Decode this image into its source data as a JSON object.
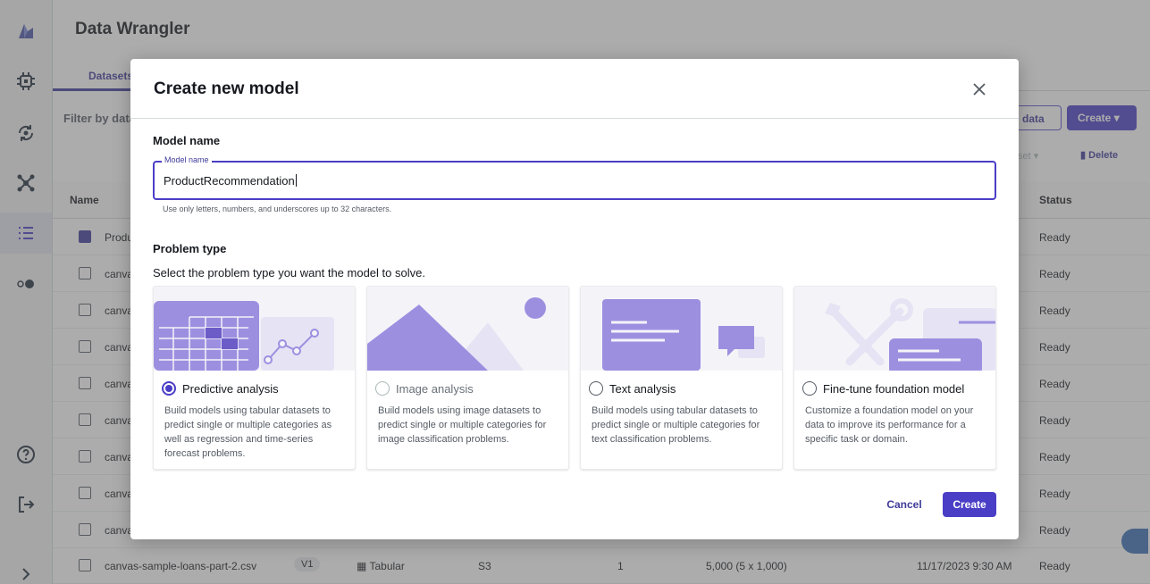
{
  "app": {
    "title": "Data Wrangler",
    "tab": "Datasets",
    "filter_label": "Filter by data",
    "import_label": "data",
    "create_label": "Create",
    "dataset_dropdown": "set",
    "delete_label": "Delete"
  },
  "table": {
    "headers": {
      "name": "Name",
      "status": "Status"
    },
    "rows": [
      {
        "name": "Produ",
        "status": "Ready",
        "checked": true
      },
      {
        "name": "canva",
        "status": "Ready"
      },
      {
        "name": "canva",
        "status": "Ready"
      },
      {
        "name": "canva",
        "status": "Ready"
      },
      {
        "name": "canva",
        "status": "Ready"
      },
      {
        "name": "canva",
        "status": "Ready"
      },
      {
        "name": "canva",
        "status": "Ready"
      },
      {
        "name": "canva",
        "status": "Ready"
      },
      {
        "name": "canva",
        "status": "Ready"
      },
      {
        "name": "canvas-sample-loans-part-2.csv",
        "version": "V1",
        "type": "Tabular",
        "source": "S3",
        "columns": "1",
        "cells": "5,000 (5 x 1,000)",
        "date": "11/17/2023 9:30 AM",
        "status": "Ready"
      }
    ]
  },
  "modal": {
    "title": "Create new model",
    "model_name_heading": "Model name",
    "model_name_legend": "Model name",
    "model_name_value": "ProductRecommendation",
    "model_name_hint": "Use only letters, numbers, and underscores up to 32 characters.",
    "problem_type_heading": "Problem type",
    "problem_type_subtext": "Select the problem type you want the model to solve.",
    "cards": [
      {
        "label": "Predictive analysis",
        "selected": true,
        "disabled": false,
        "description": "Build models using tabular datasets to predict single or multiple categories as well as regression and time-series forecast problems."
      },
      {
        "label": "Image analysis",
        "selected": false,
        "disabled": true,
        "description": "Build models using image datasets to predict single or multiple categories for image classification problems."
      },
      {
        "label": "Text analysis",
        "selected": false,
        "disabled": false,
        "description": "Build models using tabular datasets to predict single or multiple categories for text classification problems."
      },
      {
        "label": "Fine-tune foundation model",
        "selected": false,
        "disabled": false,
        "description": "Customize a foundation model on your data to improve its performance for a specific task or domain."
      }
    ],
    "cancel_label": "Cancel",
    "create_label": "Create"
  },
  "colors": {
    "accent": "#4a3ec6",
    "illustration": "#9d8fe0",
    "illustration_light": "#e6e3f4"
  },
  "icons": {
    "sidebar": [
      "logo-icon",
      "chip-icon",
      "refresh-icon",
      "network-icon",
      "list-icon",
      "toggle-icon",
      "help-icon",
      "sign-out-icon",
      "expand-icon"
    ],
    "modal_close": "close-icon"
  }
}
